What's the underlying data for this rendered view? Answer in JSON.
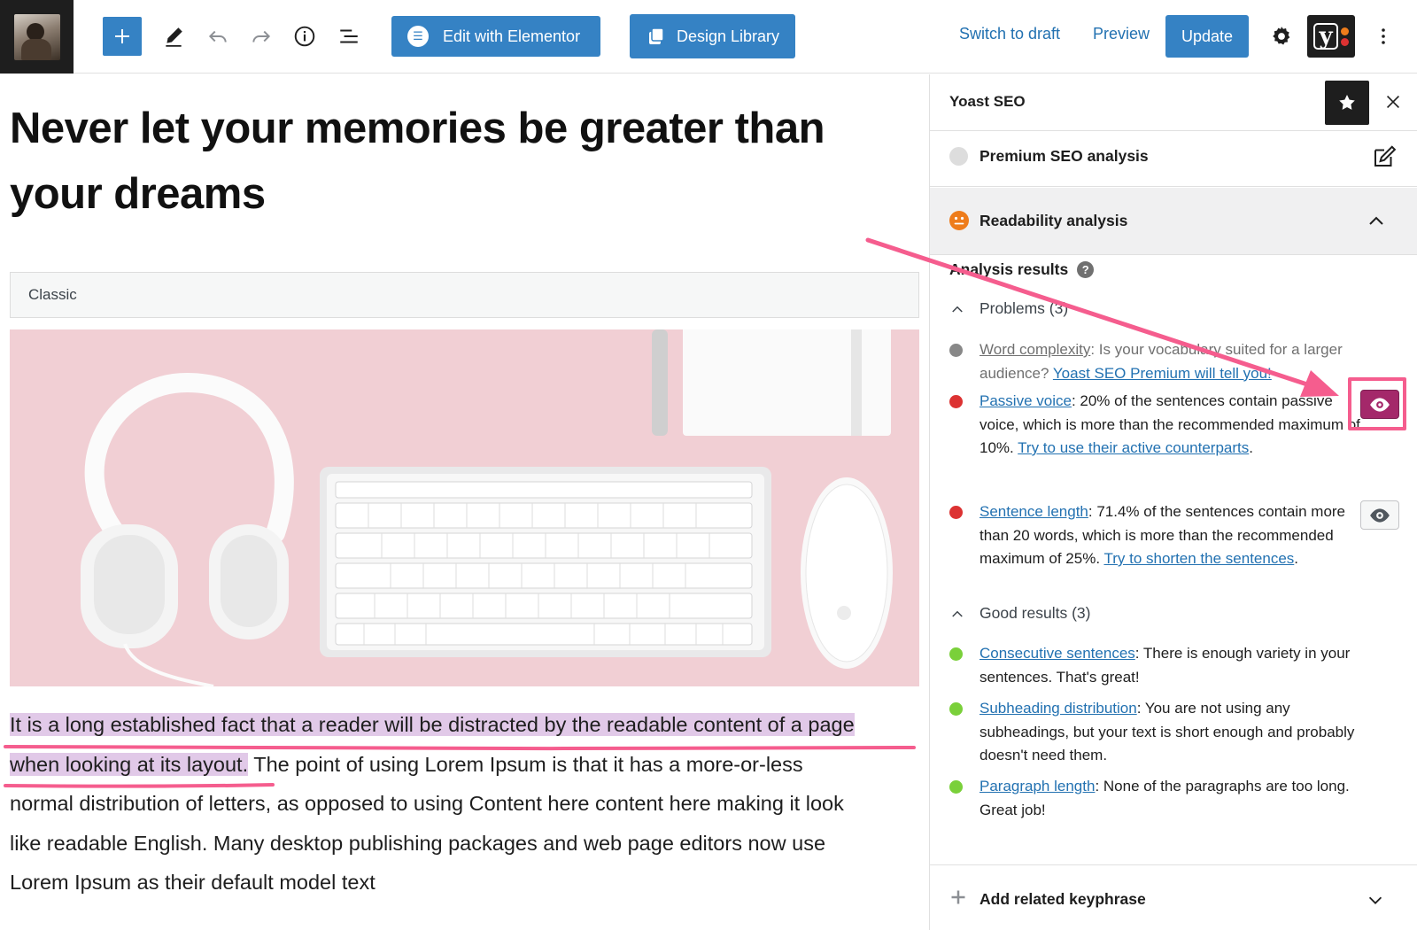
{
  "toolbar": {
    "elementor_label": "Edit with Elementor",
    "library_label": "Design Library",
    "switch_draft_label": "Switch to draft",
    "preview_label": "Preview",
    "update_label": "Update",
    "yoast_glyph": "y",
    "yoast_dot_colors": [
      "#ee7c1b",
      "#dc3232"
    ],
    "accent_color": "#3582c4"
  },
  "editor": {
    "title_line1": "Never let your memories be greater than",
    "title_line2": "your dreams",
    "classic_block_label": "Classic",
    "body": {
      "highlighted_line1": "It is a long established fact that a reader will be distracted by the readable content of a page",
      "highlighted_line2": "when looking at its layout.",
      "rest_line2": " The point of using Lorem Ipsum is that it has a more-or-less",
      "line3": "normal distribution of letters, as opposed to using Content here content here making it look",
      "line4": "like readable English. Many desktop publishing packages and web page editors now use",
      "line5": "Lorem Ipsum as their default model text"
    },
    "highlight_color": "#e1c9e8"
  },
  "sidebar": {
    "title": "Yoast SEO",
    "premium_label": "Premium SEO analysis",
    "readability_label": "Readability analysis",
    "analysis_heading": "Analysis results",
    "help_glyph": "?",
    "problems_label": "Problems (3)",
    "good_label": "Good results (3)",
    "problems": [
      {
        "link": "Word complexity",
        "text": ": Is your vocabulary suited for a larger audience? ",
        "link2": "Yoast SEO Premium will tell you!",
        "bullet_color": "#888888"
      },
      {
        "link": "Passive voice",
        "text": ": 20% of the sentences contain passive voice, which is more than the recommended maximum of 10%. ",
        "link2": "Try to use their active counterparts",
        "tail": ".",
        "bullet_color": "#dc3232"
      },
      {
        "link": "Sentence length",
        "text": ": 71.4% of the sentences contain more than 20 words, which is more than the recommended maximum of 25%. ",
        "link2": "Try to shorten the sentences",
        "tail": ".",
        "bullet_color": "#dc3232"
      }
    ],
    "good": [
      {
        "link": "Consecutive sentences",
        "text": ": There is enough variety in your sentences. That's great!",
        "bullet_color": "#7ad03a"
      },
      {
        "link": "Subheading distribution",
        "text": ": You are not using any subheadings, but your text is short enough and probably doesn't need them.",
        "bullet_color": "#7ad03a"
      },
      {
        "link": "Paragraph length",
        "text": ": None of the paragraphs are too long. Great job!",
        "bullet_color": "#7ad03a"
      }
    ],
    "related_label": "Add related keyphrase",
    "active_eye_color": "#a4286a",
    "annotation_color": "#f55d8e"
  }
}
